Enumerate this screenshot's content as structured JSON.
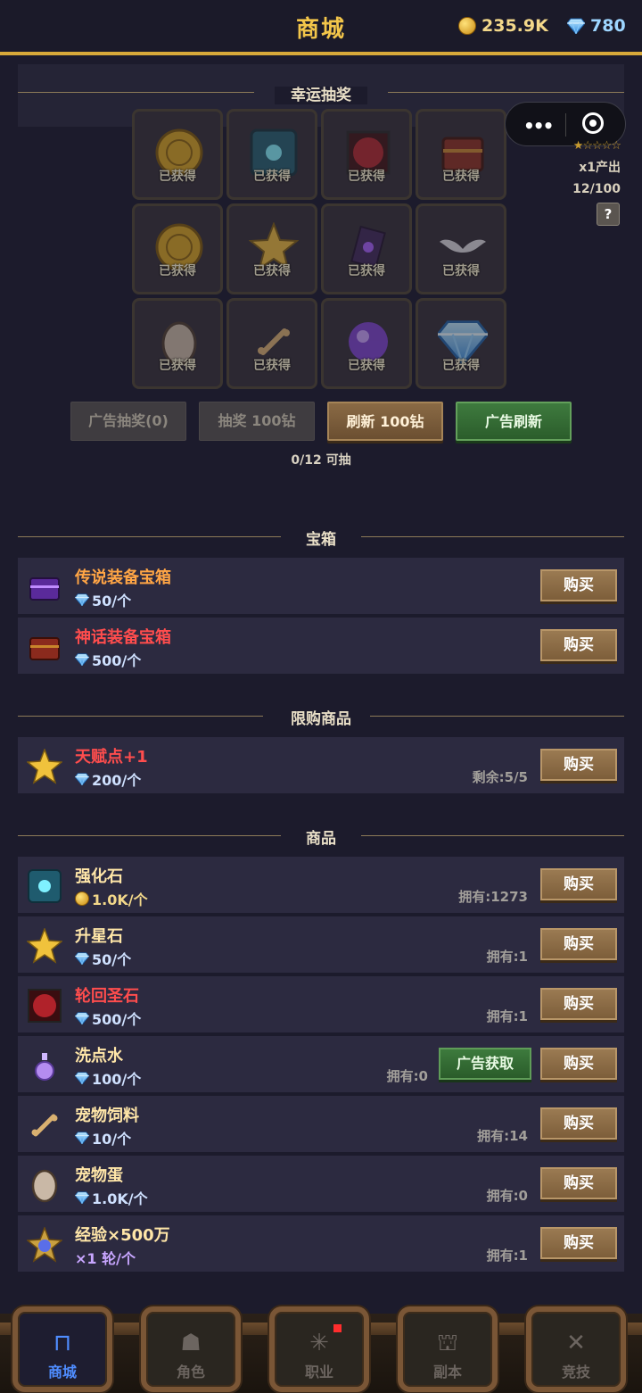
{
  "header": {
    "title": "商城",
    "gold": "235.9K",
    "diamonds": "780"
  },
  "lottery": {
    "section_title": "幸运抽奖",
    "cells": [
      {
        "item": "gold-coin-icon",
        "status": "已获得"
      },
      {
        "item": "enhance-stone-icon",
        "status": "已获得"
      },
      {
        "item": "rebirth-stone-icon",
        "status": "已获得"
      },
      {
        "item": "mythic-chest-icon",
        "status": "已获得"
      },
      {
        "item": "gold-coin-icon",
        "status": "已获得"
      },
      {
        "item": "star-stone-icon",
        "status": "已获得"
      },
      {
        "item": "purple-card-icon",
        "status": "已获得"
      },
      {
        "item": "wings-icon",
        "status": "已获得"
      },
      {
        "item": "pet-egg-icon",
        "status": "已获得"
      },
      {
        "item": "bone-icon",
        "status": "已获得"
      },
      {
        "item": "purple-orb-icon",
        "status": "已获得"
      },
      {
        "item": "diamond-icon",
        "status": "已获得"
      }
    ],
    "side_info": {
      "partial": "1",
      "stars": "★☆☆☆☆",
      "output": "x1产出",
      "progress": "12/100",
      "help": "?"
    },
    "buttons": {
      "ad_draw": "广告抽奖(0)",
      "draw": "抽奖 100钻",
      "refresh": "刷新 100钻",
      "ad_refresh": "广告刷新"
    },
    "remaining": "0/12 可抽"
  },
  "chests": {
    "section_title": "宝箱",
    "items": [
      {
        "name": "传说装备宝箱",
        "price": "50/个",
        "currency": "diamond",
        "buy": "购买"
      },
      {
        "name": "神话装备宝箱",
        "price": "500/个",
        "currency": "diamond",
        "buy": "购买"
      }
    ]
  },
  "limited": {
    "section_title": "限购商品",
    "items": [
      {
        "name": "天赋点+1",
        "price": "200/个",
        "currency": "diamond",
        "remaining": "剩余:5/5",
        "buy": "购买"
      }
    ]
  },
  "goods": {
    "section_title": "商品",
    "items": [
      {
        "name": "强化石",
        "price": "1.0K/个",
        "currency": "gold",
        "own": "拥有:1273",
        "buy": "购买"
      },
      {
        "name": "升星石",
        "price": "50/个",
        "currency": "diamond",
        "own": "拥有:1",
        "buy": "购买"
      },
      {
        "name": "轮回圣石",
        "price": "500/个",
        "currency": "diamond",
        "own": "拥有:1",
        "buy": "购买"
      },
      {
        "name": "洗点水",
        "price": "100/个",
        "currency": "diamond",
        "own": "拥有:0",
        "ad": "广告获取",
        "buy": "购买"
      },
      {
        "name": "宠物饲料",
        "price": "10/个",
        "currency": "diamond",
        "own": "拥有:14",
        "buy": "购买"
      },
      {
        "name": "宠物蛋",
        "price": "1.0K/个",
        "currency": "diamond",
        "own": "拥有:0",
        "buy": "购买"
      },
      {
        "name": "经验×500万",
        "price": "×1 轮/个",
        "currency": "none",
        "own": "拥有:1",
        "buy": "购买"
      }
    ]
  },
  "nav": {
    "tabs": [
      {
        "label": "商城",
        "icon": "shop-icon",
        "active": true
      },
      {
        "label": "角色",
        "icon": "character-icon",
        "active": false
      },
      {
        "label": "职业",
        "icon": "class-icon",
        "active": false,
        "badge": true
      },
      {
        "label": "副本",
        "icon": "dungeon-icon",
        "active": false
      },
      {
        "label": "竞技",
        "icon": "arena-icon",
        "active": false
      }
    ]
  },
  "colors": {
    "accent_gold": "#d8a93a",
    "title_gold": "#f3c64a",
    "legend_orange": "#ffa545",
    "mythic_red": "#ff4d4d",
    "active_tab_blue": "#4f8dff"
  }
}
